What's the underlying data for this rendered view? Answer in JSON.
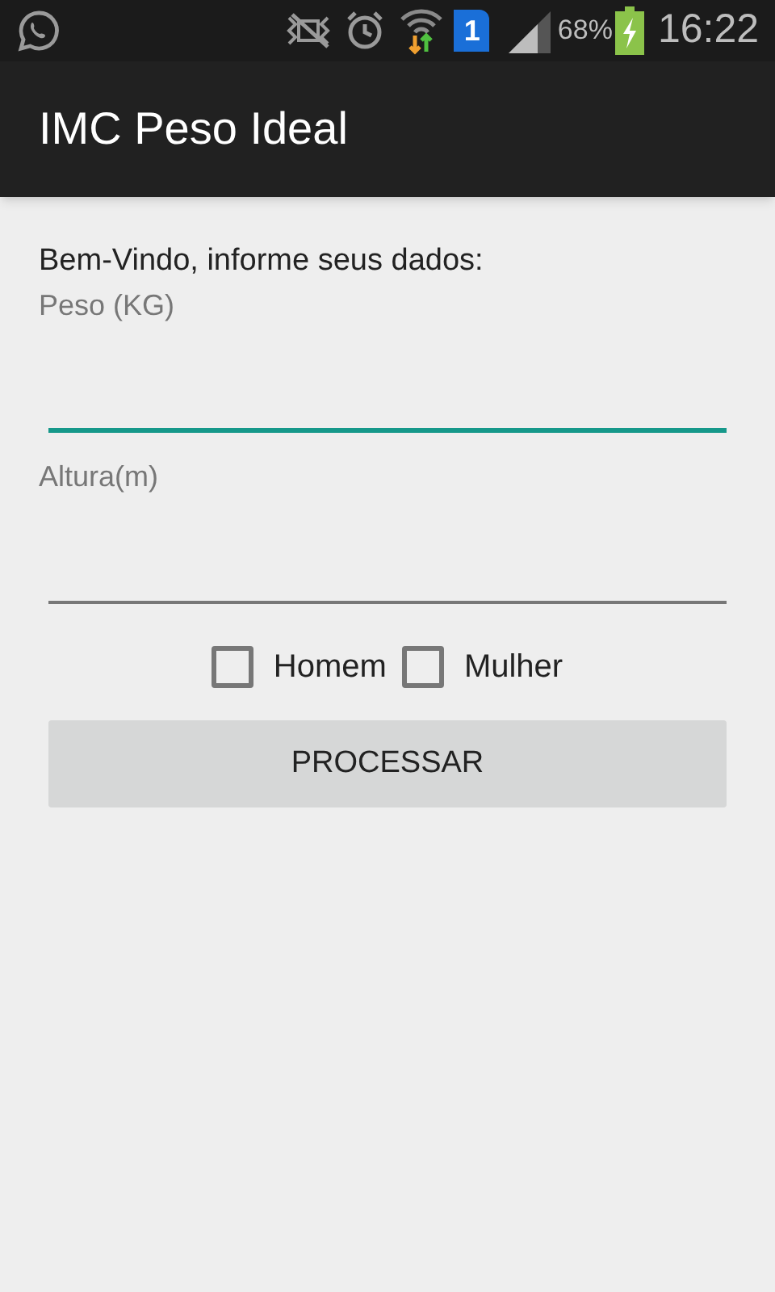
{
  "status_bar": {
    "sim_number": "1",
    "battery_percent": "68%",
    "time": "16:22"
  },
  "app_bar": {
    "title": "IMC Peso Ideal"
  },
  "intro": "Bem-Vindo, informe seus dados:",
  "fields": [
    {
      "label": "Peso (KG)",
      "focused": true
    },
    {
      "label": "Altura(m)",
      "focused": false
    }
  ],
  "checkboxes": [
    {
      "label": "Homem",
      "checked": false
    },
    {
      "label": "Mulher",
      "checked": false
    }
  ],
  "button": "PROCESSAR"
}
